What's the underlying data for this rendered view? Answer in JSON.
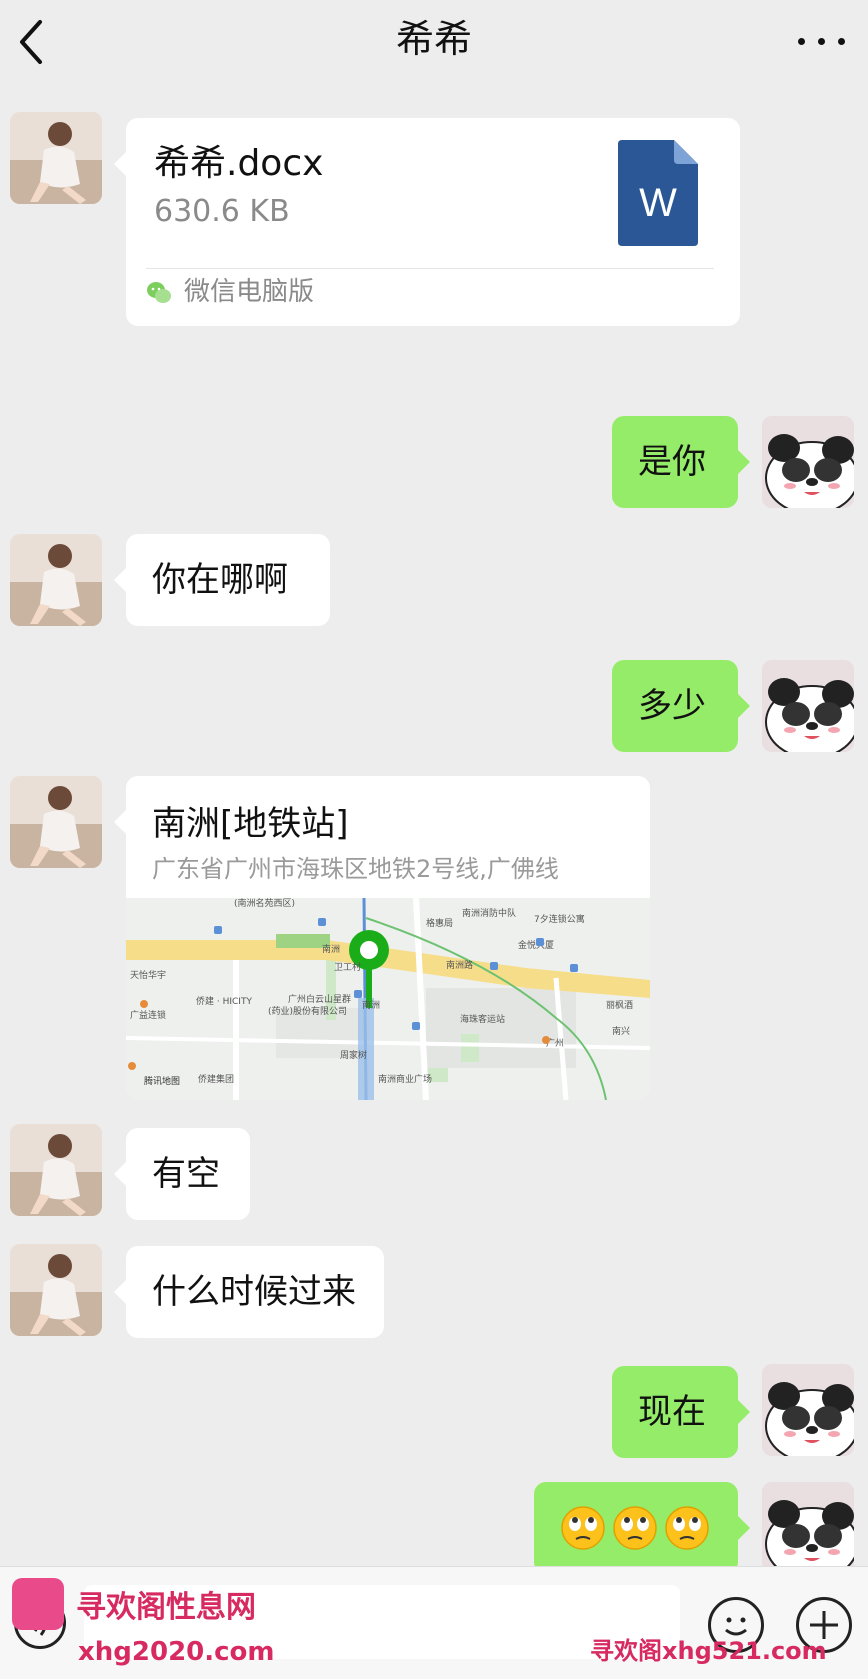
{
  "header": {
    "title": "希希",
    "back_icon": "chevron-left-icon",
    "more_icon": "more-dots-icon"
  },
  "messages": [
    {
      "type": "file",
      "from": "contact",
      "file_name": "希希.docx",
      "file_size": "630.6 KB",
      "file_icon": "word-document-icon",
      "source": "微信电脑版"
    },
    {
      "type": "text",
      "from": "me",
      "text": "是你"
    },
    {
      "type": "text",
      "from": "contact",
      "text": "你在哪啊"
    },
    {
      "type": "text",
      "from": "me",
      "text": "多少"
    },
    {
      "type": "location",
      "from": "contact",
      "title": "南洲[地铁站]",
      "address": "广东省广州市海珠区地铁2号线,广佛线",
      "map_labels": {
        "l1": "(南洲名苑西区)",
        "l2": "南洲消防中队",
        "l3": "7夕连锁公寓",
        "l4": "格惠局",
        "l5": "南洲",
        "l6": "金悦大厦",
        "l7": "卫工村",
        "l8": "南洲路",
        "l9": "天怡华宇",
        "l10": "侨建 · HICITY",
        "l11": "广州白云山星群",
        "l12": "(药业)股份有限公司",
        "l13": "南洲",
        "l14": "海珠客运站",
        "l15": "广益连锁",
        "l16": "周家树",
        "l17": "侨建集团",
        "l18": "南洲商业广场",
        "l19": "腾讯地图",
        "l20": "丽枫酒",
        "l21": "南兴",
        "l22": "广州"
      }
    },
    {
      "type": "text",
      "from": "contact",
      "text": "有空"
    },
    {
      "type": "text",
      "from": "contact",
      "text": "什么时候过来"
    },
    {
      "type": "text",
      "from": "me",
      "text": "现在"
    },
    {
      "type": "emoji",
      "from": "me",
      "emoji_icons": [
        "rolling-eyes-emoji",
        "rolling-eyes-emoji",
        "rolling-eyes-emoji"
      ]
    }
  ],
  "input_bar": {
    "voice_icon": "voice-icon",
    "emoji_icon": "smiley-icon",
    "plus_icon": "plus-icon",
    "placeholder": ""
  },
  "watermarks": {
    "top_left": "寻欢阁性息网",
    "bottom_left": "xhg2020.com",
    "bottom_right": "寻欢阁xhg521.com"
  },
  "colors": {
    "background": "#ededed",
    "outgoing_bubble": "#95ec69",
    "incoming_bubble": "#ffffff",
    "map_pin": "#1aad19",
    "word_icon": "#2b5797",
    "watermark": "#d72a60"
  }
}
